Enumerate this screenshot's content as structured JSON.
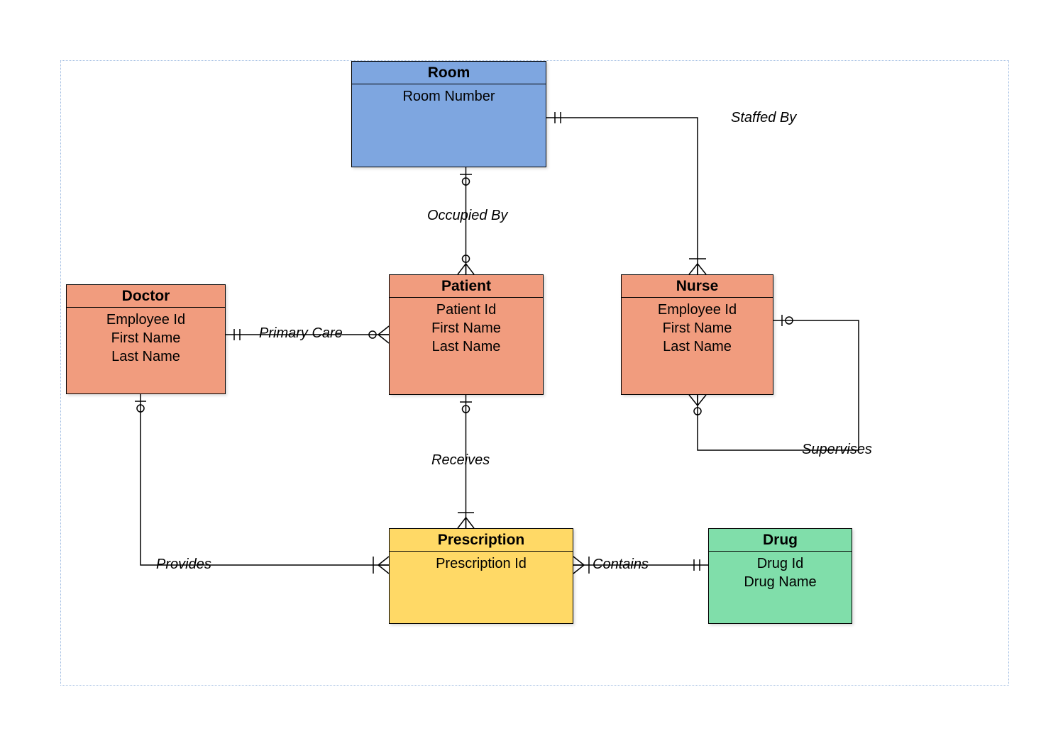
{
  "entities": {
    "room": {
      "title": "Room",
      "attr1": "Room Number",
      "attr2": "",
      "attr3": ""
    },
    "doctor": {
      "title": "Doctor",
      "attr1": "Employee Id",
      "attr2": "First Name",
      "attr3": "Last Name"
    },
    "patient": {
      "title": "Patient",
      "attr1": "Patient Id",
      "attr2": "First Name",
      "attr3": "Last Name"
    },
    "nurse": {
      "title": "Nurse",
      "attr1": "Employee Id",
      "attr2": "First Name",
      "attr3": "Last Name"
    },
    "prescription": {
      "title": "Prescription",
      "attr1": "Prescription Id",
      "attr2": "",
      "attr3": ""
    },
    "drug": {
      "title": "Drug",
      "attr1": "Drug Id",
      "attr2": "Drug Name",
      "attr3": ""
    }
  },
  "relationships": {
    "staffed": {
      "label": "Staffed By"
    },
    "occupied": {
      "label": "Occupied By"
    },
    "primary": {
      "label": "Primary Care"
    },
    "receives": {
      "label": "Receives"
    },
    "provides": {
      "label": "Provides"
    },
    "contains": {
      "label": "Contains"
    },
    "supervises": {
      "label": "Supervises"
    }
  }
}
